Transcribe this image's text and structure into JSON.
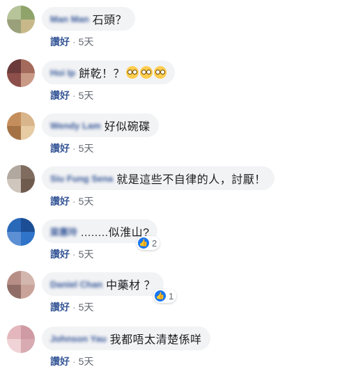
{
  "meta_labels": {
    "like": "讚好",
    "separator": "·"
  },
  "comments": [
    {
      "author": "Man Man",
      "text": "石頭？",
      "time": "5天",
      "emoji_count": 0,
      "reactions": null,
      "avatar_colors": [
        "#b7c49a",
        "#8fa36a",
        "#9aa07a",
        "#c9b98a"
      ]
    },
    {
      "author": "Hoi Ip",
      "text": "餅乾！？",
      "time": "5天",
      "emoji_count": 3,
      "reactions": null,
      "avatar_colors": [
        "#6b3a3a",
        "#a46b5c",
        "#8d4f4a",
        "#c99a86"
      ]
    },
    {
      "author": "Wendy Lam",
      "text": "好似碗碟",
      "time": "5天",
      "emoji_count": 0,
      "reactions": null,
      "avatar_colors": [
        "#c48e5c",
        "#d9b58c",
        "#a57246",
        "#e6cba3"
      ]
    },
    {
      "author": "Siu Fung Sena",
      "text": "就是這些不自律的人，討厭！",
      "time": "5天",
      "emoji_count": 0,
      "reactions": null,
      "avatar_colors": [
        "#b1a89f",
        "#7f6c5f",
        "#cfc6bd",
        "#6f5a4e"
      ]
    },
    {
      "author": "梁惠玲",
      "text": "........似淮山?",
      "time": "5天",
      "emoji_count": 0,
      "reactions": "2",
      "avatar_colors": [
        "#2a68b8",
        "#1b4e94",
        "#5d8fd4",
        "#2f74c9"
      ]
    },
    {
      "author": "Daniel Chan",
      "text": "中藥材 ？",
      "time": "5天",
      "emoji_count": 0,
      "reactions": "1",
      "avatar_colors": [
        "#b78e86",
        "#d3b6ad",
        "#8f6d66",
        "#c9a39a"
      ]
    },
    {
      "author": "Johnson Yau",
      "text": "我都唔太清楚係咩",
      "time": "5天",
      "emoji_count": 0,
      "reactions": null,
      "avatar_colors": [
        "#e3b7bd",
        "#cf9aa3",
        "#f0d3d6",
        "#d8aab1"
      ]
    }
  ]
}
